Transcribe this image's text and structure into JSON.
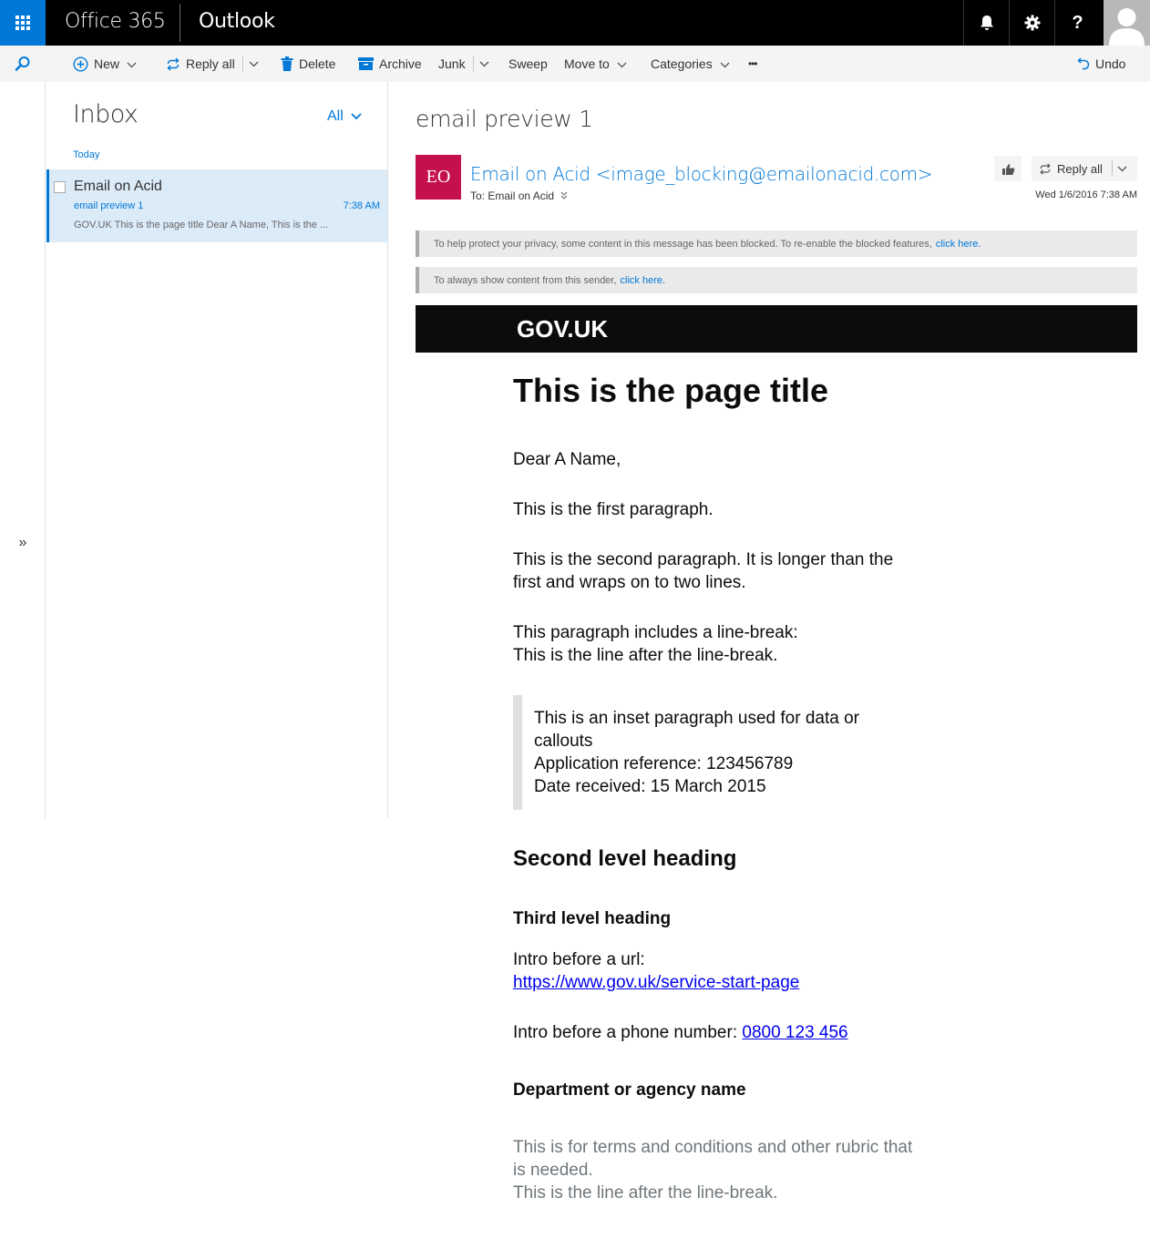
{
  "topbar": {
    "brand": "Office 365",
    "app": "Outlook",
    "help": "?"
  },
  "commands": {
    "new": "New",
    "reply_all": "Reply all",
    "delete": "Delete",
    "archive": "Archive",
    "junk": "Junk",
    "sweep": "Sweep",
    "move_to": "Move to",
    "categories": "Categories",
    "more": "•••",
    "undo": "Undo"
  },
  "rail": {
    "expand": "»"
  },
  "msglist": {
    "title": "Inbox",
    "filter": "All",
    "group": "Today",
    "items": [
      {
        "from": "Email on Acid",
        "subject": "email preview 1",
        "time": "7:38 AM",
        "preview": "GOV.UK  This is the page title  Dear A Name,   This is the ..."
      }
    ]
  },
  "reading": {
    "subject": "email preview 1",
    "initials": "EO",
    "sender": "Email on Acid <image_blocking@emailonacid.com>",
    "to_label": "To:",
    "to": "Email on Acid",
    "reply_all": "Reply all",
    "date": "Wed 1/6/2016 7:38 AM",
    "notice1": "To help protect your privacy, some content in this message has been blocked. To re-enable the blocked features,",
    "notice1_link": "click here.",
    "notice2": "To always show content from this sender,",
    "notice2_link": "click here."
  },
  "email": {
    "logo": "GOV.UK",
    "title": "This is the page title",
    "greeting": "Dear A Name,",
    "p1": "This is the first paragraph.",
    "p2": "This is the second paragraph. It is longer than the first and wraps on to two lines.",
    "p3_line1": "This paragraph includes a line-break:",
    "p3_line2": "This is the line after the line-break.",
    "inset_line1": "This is an inset paragraph used for data or callouts",
    "inset_line2": "Application reference: 123456789",
    "inset_line3": "Date received: 15 March 2015",
    "h2": "Second level heading",
    "h3": "Third level heading",
    "url_intro": "Intro before a url:",
    "url": "https://www.gov.uk/service-start-page",
    "phone_intro": "Intro before a phone number:",
    "phone": "0800 123 456",
    "department": "Department or agency name",
    "rubric_line1": "This is for terms and conditions and other rubric that is needed.",
    "rubric_line2": "This is the line after the line-break."
  },
  "colors": {
    "accent": "#0078d7",
    "badge": "#c4104e",
    "gov_bar": "#0b0c0c",
    "selected_row": "#dcebf8"
  }
}
